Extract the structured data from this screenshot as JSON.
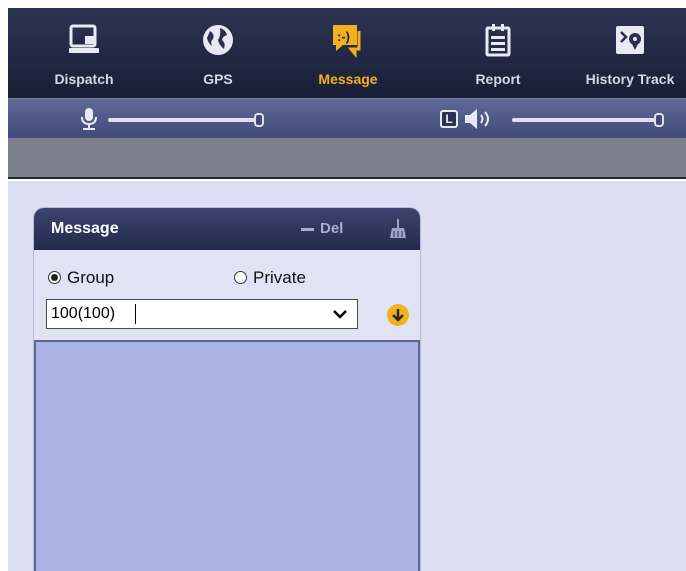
{
  "toolbar": {
    "items": [
      {
        "label": "Dispatch",
        "icon": "dispatch-icon"
      },
      {
        "label": "GPS",
        "icon": "globe-icon"
      },
      {
        "label": "Message",
        "icon": "message-icon",
        "active": true
      },
      {
        "label": "Report",
        "icon": "report-icon"
      },
      {
        "label": "History Track",
        "icon": "history-track-icon"
      }
    ]
  },
  "volume": {
    "mic_level": 1.0,
    "speaker_level": 1.0,
    "speaker_mode_label": "L"
  },
  "message_panel": {
    "title": "Message",
    "del_label": "Del",
    "radio_group": "Group",
    "radio_private": "Private",
    "selected_radio": "Group",
    "select_value": "100(100)"
  },
  "colors": {
    "active_tab": "#f2b01e",
    "toolbar_bg": "#1a1f37",
    "message_area": "#abb3e5",
    "workspace": "#dcdff3"
  }
}
